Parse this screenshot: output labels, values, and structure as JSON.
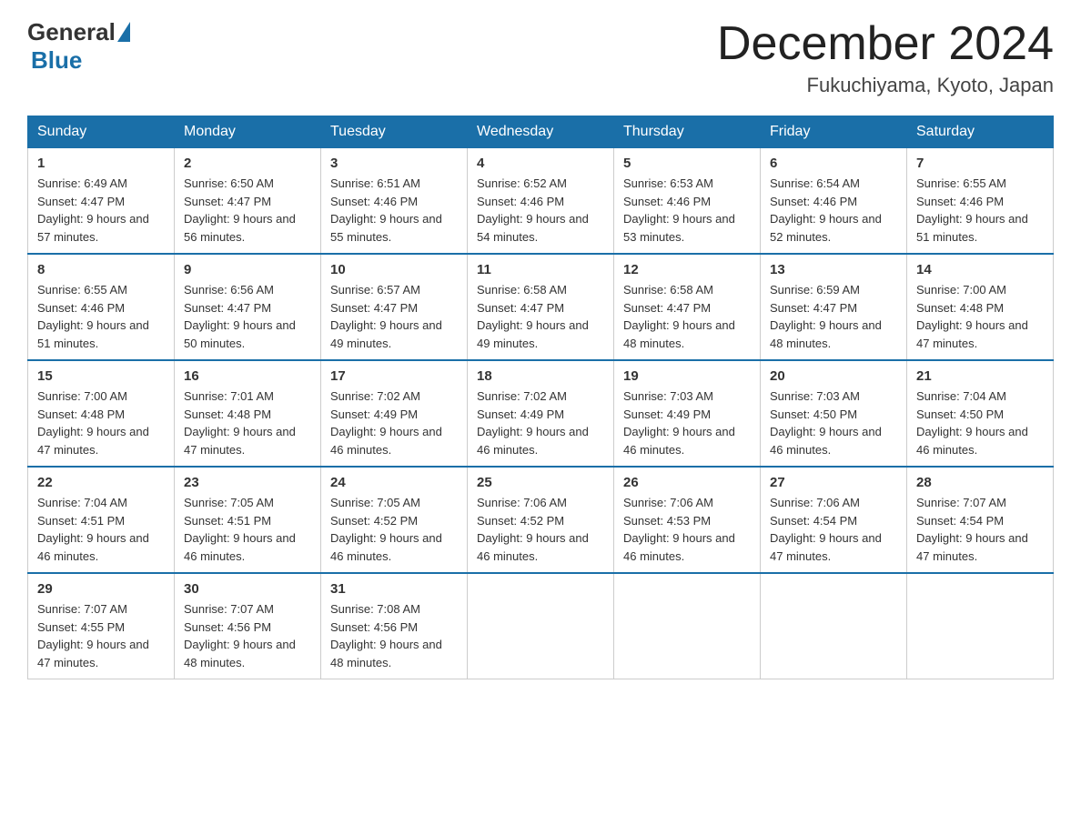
{
  "logo": {
    "general": "General",
    "blue": "Blue"
  },
  "title": "December 2024",
  "location": "Fukuchiyama, Kyoto, Japan",
  "days_of_week": [
    "Sunday",
    "Monday",
    "Tuesday",
    "Wednesday",
    "Thursday",
    "Friday",
    "Saturday"
  ],
  "weeks": [
    [
      {
        "day": "1",
        "sunrise": "Sunrise: 6:49 AM",
        "sunset": "Sunset: 4:47 PM",
        "daylight": "Daylight: 9 hours and 57 minutes."
      },
      {
        "day": "2",
        "sunrise": "Sunrise: 6:50 AM",
        "sunset": "Sunset: 4:47 PM",
        "daylight": "Daylight: 9 hours and 56 minutes."
      },
      {
        "day": "3",
        "sunrise": "Sunrise: 6:51 AM",
        "sunset": "Sunset: 4:46 PM",
        "daylight": "Daylight: 9 hours and 55 minutes."
      },
      {
        "day": "4",
        "sunrise": "Sunrise: 6:52 AM",
        "sunset": "Sunset: 4:46 PM",
        "daylight": "Daylight: 9 hours and 54 minutes."
      },
      {
        "day": "5",
        "sunrise": "Sunrise: 6:53 AM",
        "sunset": "Sunset: 4:46 PM",
        "daylight": "Daylight: 9 hours and 53 minutes."
      },
      {
        "day": "6",
        "sunrise": "Sunrise: 6:54 AM",
        "sunset": "Sunset: 4:46 PM",
        "daylight": "Daylight: 9 hours and 52 minutes."
      },
      {
        "day": "7",
        "sunrise": "Sunrise: 6:55 AM",
        "sunset": "Sunset: 4:46 PM",
        "daylight": "Daylight: 9 hours and 51 minutes."
      }
    ],
    [
      {
        "day": "8",
        "sunrise": "Sunrise: 6:55 AM",
        "sunset": "Sunset: 4:46 PM",
        "daylight": "Daylight: 9 hours and 51 minutes."
      },
      {
        "day": "9",
        "sunrise": "Sunrise: 6:56 AM",
        "sunset": "Sunset: 4:47 PM",
        "daylight": "Daylight: 9 hours and 50 minutes."
      },
      {
        "day": "10",
        "sunrise": "Sunrise: 6:57 AM",
        "sunset": "Sunset: 4:47 PM",
        "daylight": "Daylight: 9 hours and 49 minutes."
      },
      {
        "day": "11",
        "sunrise": "Sunrise: 6:58 AM",
        "sunset": "Sunset: 4:47 PM",
        "daylight": "Daylight: 9 hours and 49 minutes."
      },
      {
        "day": "12",
        "sunrise": "Sunrise: 6:58 AM",
        "sunset": "Sunset: 4:47 PM",
        "daylight": "Daylight: 9 hours and 48 minutes."
      },
      {
        "day": "13",
        "sunrise": "Sunrise: 6:59 AM",
        "sunset": "Sunset: 4:47 PM",
        "daylight": "Daylight: 9 hours and 48 minutes."
      },
      {
        "day": "14",
        "sunrise": "Sunrise: 7:00 AM",
        "sunset": "Sunset: 4:48 PM",
        "daylight": "Daylight: 9 hours and 47 minutes."
      }
    ],
    [
      {
        "day": "15",
        "sunrise": "Sunrise: 7:00 AM",
        "sunset": "Sunset: 4:48 PM",
        "daylight": "Daylight: 9 hours and 47 minutes."
      },
      {
        "day": "16",
        "sunrise": "Sunrise: 7:01 AM",
        "sunset": "Sunset: 4:48 PM",
        "daylight": "Daylight: 9 hours and 47 minutes."
      },
      {
        "day": "17",
        "sunrise": "Sunrise: 7:02 AM",
        "sunset": "Sunset: 4:49 PM",
        "daylight": "Daylight: 9 hours and 46 minutes."
      },
      {
        "day": "18",
        "sunrise": "Sunrise: 7:02 AM",
        "sunset": "Sunset: 4:49 PM",
        "daylight": "Daylight: 9 hours and 46 minutes."
      },
      {
        "day": "19",
        "sunrise": "Sunrise: 7:03 AM",
        "sunset": "Sunset: 4:49 PM",
        "daylight": "Daylight: 9 hours and 46 minutes."
      },
      {
        "day": "20",
        "sunrise": "Sunrise: 7:03 AM",
        "sunset": "Sunset: 4:50 PM",
        "daylight": "Daylight: 9 hours and 46 minutes."
      },
      {
        "day": "21",
        "sunrise": "Sunrise: 7:04 AM",
        "sunset": "Sunset: 4:50 PM",
        "daylight": "Daylight: 9 hours and 46 minutes."
      }
    ],
    [
      {
        "day": "22",
        "sunrise": "Sunrise: 7:04 AM",
        "sunset": "Sunset: 4:51 PM",
        "daylight": "Daylight: 9 hours and 46 minutes."
      },
      {
        "day": "23",
        "sunrise": "Sunrise: 7:05 AM",
        "sunset": "Sunset: 4:51 PM",
        "daylight": "Daylight: 9 hours and 46 minutes."
      },
      {
        "day": "24",
        "sunrise": "Sunrise: 7:05 AM",
        "sunset": "Sunset: 4:52 PM",
        "daylight": "Daylight: 9 hours and 46 minutes."
      },
      {
        "day": "25",
        "sunrise": "Sunrise: 7:06 AM",
        "sunset": "Sunset: 4:52 PM",
        "daylight": "Daylight: 9 hours and 46 minutes."
      },
      {
        "day": "26",
        "sunrise": "Sunrise: 7:06 AM",
        "sunset": "Sunset: 4:53 PM",
        "daylight": "Daylight: 9 hours and 46 minutes."
      },
      {
        "day": "27",
        "sunrise": "Sunrise: 7:06 AM",
        "sunset": "Sunset: 4:54 PM",
        "daylight": "Daylight: 9 hours and 47 minutes."
      },
      {
        "day": "28",
        "sunrise": "Sunrise: 7:07 AM",
        "sunset": "Sunset: 4:54 PM",
        "daylight": "Daylight: 9 hours and 47 minutes."
      }
    ],
    [
      {
        "day": "29",
        "sunrise": "Sunrise: 7:07 AM",
        "sunset": "Sunset: 4:55 PM",
        "daylight": "Daylight: 9 hours and 47 minutes."
      },
      {
        "day": "30",
        "sunrise": "Sunrise: 7:07 AM",
        "sunset": "Sunset: 4:56 PM",
        "daylight": "Daylight: 9 hours and 48 minutes."
      },
      {
        "day": "31",
        "sunrise": "Sunrise: 7:08 AM",
        "sunset": "Sunset: 4:56 PM",
        "daylight": "Daylight: 9 hours and 48 minutes."
      },
      null,
      null,
      null,
      null
    ]
  ]
}
